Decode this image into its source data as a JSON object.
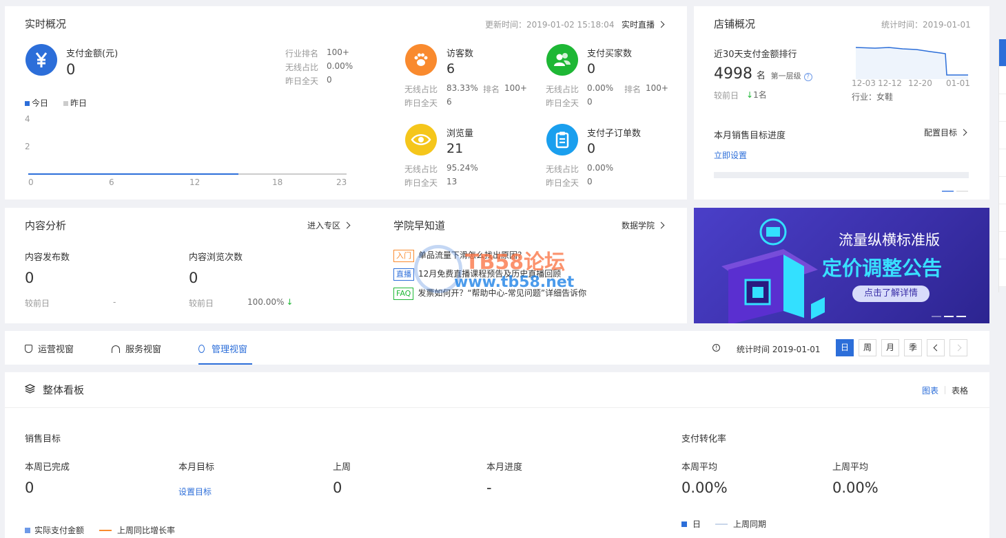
{
  "realtime": {
    "title": "实时概况",
    "update_time": "更新时间：2019-01-02 15:18:04",
    "live_link": "实时直播",
    "pay_amount": {
      "label": "支付金额(元)",
      "value": "0",
      "icon": "yen-icon",
      "color": "#2c6ed9"
    },
    "rank_label": "行业排名",
    "rank_value": "100+",
    "wireless_label": "无线占比",
    "wireless_value": "0.00%",
    "yesterday_label": "昨日全天",
    "yesterday_value": "0",
    "legend_today": "今日",
    "legend_yesterday": "昨日",
    "chart": {
      "y_ticks": [
        "4",
        "2"
      ],
      "x_ticks": [
        "0",
        "6",
        "12",
        "18",
        "23"
      ],
      "today_color": "#2c6ed9",
      "yesterday_color": "#cccccc",
      "today_progress": 0.66
    },
    "metrics": [
      {
        "name": "访客数",
        "value": "6",
        "icon": "paw-icon",
        "color": "#f98a2e",
        "l1": "无线占比",
        "v1": "83.33%",
        "l2": "排名",
        "v2": "100+",
        "l3": "昨日全天",
        "v3": "6"
      },
      {
        "name": "支付买家数",
        "value": "0",
        "icon": "buyers-icon",
        "color": "#1eb735",
        "l1": "无线占比",
        "v1": "0.00%",
        "l2": "排名",
        "v2": "100+",
        "l3": "昨日全天",
        "v3": "0"
      },
      {
        "name": "浏览量",
        "value": "21",
        "icon": "eye-icon",
        "color": "#f5c61b",
        "l1": "无线占比",
        "v1": "95.24%",
        "l2": "",
        "v2": "",
        "l3": "昨日全天",
        "v3": "13"
      },
      {
        "name": "支付子订单数",
        "value": "0",
        "icon": "clipboard-icon",
        "color": "#1a9fee",
        "l1": "无线占比",
        "v1": "0.00%",
        "l2": "",
        "v2": "",
        "l3": "昨日全天",
        "v3": "0"
      }
    ]
  },
  "shop": {
    "title": "店铺概况",
    "stat_time": "统计时间：2019-01-01",
    "rank_title": "近30天支付金额排行",
    "rank_value": "4998",
    "rank_unit": "名",
    "tier": "第一层级",
    "compare_label": "较前日",
    "compare_value": "1名",
    "spark_ticks": [
      "12-03",
      "12-12",
      "12-20",
      "01-01"
    ],
    "industry": "行业：女鞋",
    "target_title": "本月销售目标进度",
    "target_config": "配置目标",
    "set_now": "立即设置",
    "target_progress": 0
  },
  "content": {
    "title": "内容分析",
    "enter": "进入专区",
    "publish_label": "内容发布数",
    "publish_value": "0",
    "view_label": "内容浏览次数",
    "view_value": "0",
    "cmp1_label": "较前日",
    "cmp1_value": "-",
    "cmp2_label": "较前日",
    "cmp2_value": "100.00%"
  },
  "academy": {
    "title": "学院早知道",
    "link": "数据学院",
    "items": [
      {
        "tag": "入门",
        "text": "单品流量下滑怎么找出原因？",
        "color": "#f98a2e"
      },
      {
        "tag": "直播",
        "text": "12月免费直播课程预告及历史直播回顾",
        "color": "#2c6ed9"
      },
      {
        "tag": "FAQ",
        "text": "发票如何开？“帮助中心-常见问题”详细告诉你",
        "color": "#1eb735"
      }
    ]
  },
  "banner": {
    "line1": "流量纵横标准版",
    "line2": "定价调整公告",
    "button": "点击了解详情"
  },
  "watermark": {
    "line1": "TB58论坛",
    "line2": "www.tb58.net"
  },
  "tabs": {
    "items": [
      {
        "label": "运营视窗",
        "icon": "shield-icon"
      },
      {
        "label": "服务视窗",
        "icon": "headset-icon"
      },
      {
        "label": "管理视窗",
        "icon": "medal-icon",
        "active": true
      }
    ],
    "stat_time": "统计时间 2019-01-01",
    "periods": [
      "日",
      "周",
      "月",
      "季"
    ],
    "active_period": "日"
  },
  "board": {
    "title": "整体看板",
    "view_chart": "图表",
    "view_table": "表格",
    "sales_title": "销售目标",
    "sales": [
      {
        "label": "本周已完成",
        "value": "0"
      },
      {
        "label": "本月目标",
        "value": "设置目标",
        "link": true
      },
      {
        "label": "上周",
        "value": "0"
      },
      {
        "label": "本月进度",
        "value": "-"
      }
    ],
    "conv_title": "支付转化率",
    "conv": [
      {
        "label": "本周平均",
        "value": "0.00%"
      },
      {
        "label": "上周平均",
        "value": "0.00%"
      }
    ],
    "legend_left": [
      {
        "label": "实际支付金额",
        "color": "#6e9ae8"
      },
      {
        "label": "上周同比增长率",
        "color": "#f98a2e"
      }
    ],
    "legend_right": [
      {
        "label": "日",
        "color": "#2c6ed9"
      },
      {
        "label": "上周同期",
        "color": "#c9d6ea"
      }
    ]
  }
}
